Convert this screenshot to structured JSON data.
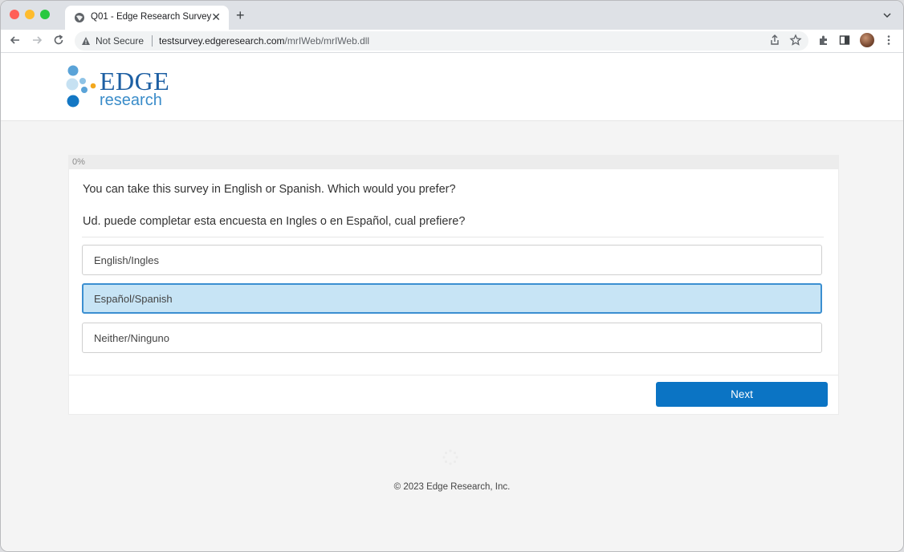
{
  "browser": {
    "tab_title": "Q01 - Edge Research Survey",
    "security_label": "Not Secure",
    "url_host": "testsurvey.edgeresearch.com",
    "url_path": "/mrIWeb/mrIWeb.dll"
  },
  "site": {
    "logo_word": "EDGE",
    "logo_sub": "research"
  },
  "survey": {
    "progress_percent": 0,
    "progress_label": "0%",
    "question_en": "You can take this survey in English or Spanish. Which would you prefer?",
    "question_es": "Ud. puede completar esta encuesta en Ingles o en Español, cual prefiere?",
    "options": [
      {
        "label": "English/Ingles",
        "selected": false
      },
      {
        "label": "Español/Spanish",
        "selected": true
      },
      {
        "label": "Neither/Ninguno",
        "selected": false
      }
    ],
    "next_label": "Next"
  },
  "footer": {
    "copyright": "© 2023 Edge Research, Inc."
  },
  "colors": {
    "accent": "#0b74c4",
    "selected_bg": "#c7e4f5",
    "selected_border": "#3b8fd1",
    "logo_dark": "#1d5fa3",
    "logo_orange": "#f3a81d"
  }
}
